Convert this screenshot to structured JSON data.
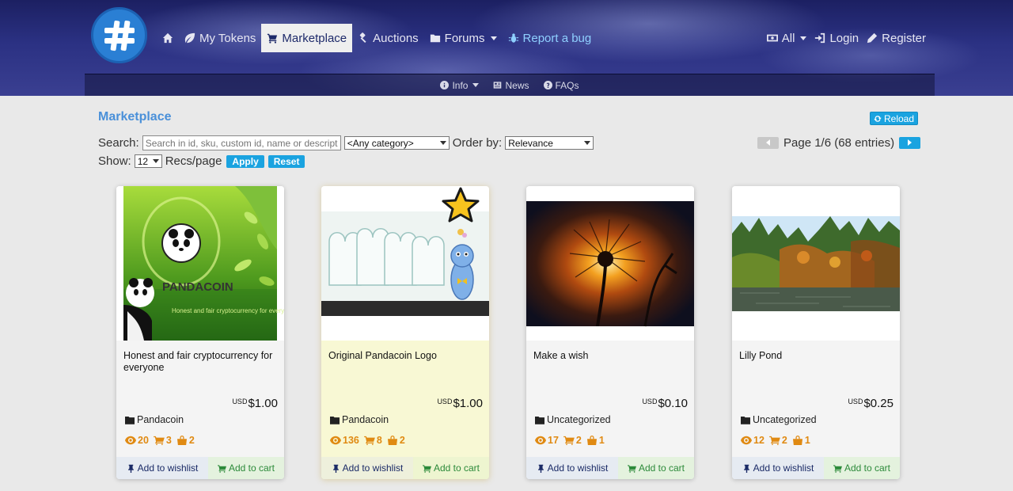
{
  "nav": {
    "home_label": "",
    "items": [
      {
        "label": "My Tokens"
      },
      {
        "label": "Marketplace"
      },
      {
        "label": "Auctions"
      },
      {
        "label": "Forums"
      },
      {
        "label": "Report a bug"
      }
    ],
    "right": [
      {
        "label": "All"
      },
      {
        "label": "Login"
      },
      {
        "label": "Register"
      }
    ]
  },
  "subnav": [
    {
      "label": "Info"
    },
    {
      "label": "News"
    },
    {
      "label": "FAQs"
    }
  ],
  "page": {
    "title": "Marketplace",
    "reload_label": "Reload"
  },
  "filters": {
    "search_label": "Search:",
    "search_placeholder": "Search in id, sku, custom id, name or description",
    "category_value": "<Any category>",
    "order_label": "Order by:",
    "order_value": "Relevance",
    "show_label": "Show:",
    "show_value": "12",
    "recs_label": "Recs/page",
    "apply_label": "Apply",
    "reset_label": "Reset"
  },
  "pager": {
    "text": "Page 1/6 (68 entries)"
  },
  "colors": {
    "accent": "#1aa3e0",
    "title": "#4a90d9",
    "stats": "#e08a12"
  },
  "cards": [
    {
      "title": "Honest and fair cryptocurrency for everyone",
      "currency": "USD",
      "price": "$1.00",
      "category": "Pandacoin",
      "views": "20",
      "carts": "3",
      "sold": "2",
      "featured": false,
      "image_text": "PANDACOIN",
      "image_tagline": "Honest and fair cryptocurrency for everyone",
      "wishlist_label": "Add to wishlist",
      "cart_label": "Add to cart"
    },
    {
      "title": "Original Pandacoin Logo",
      "currency": "USD",
      "price": "$1.00",
      "category": "Pandacoin",
      "views": "136",
      "carts": "8",
      "sold": "2",
      "featured": true,
      "wishlist_label": "Add to wishlist",
      "cart_label": "Add to cart"
    },
    {
      "title": "Make a wish",
      "currency": "USD",
      "price": "$0.10",
      "category": "Uncategorized",
      "views": "17",
      "carts": "2",
      "sold": "1",
      "featured": false,
      "wishlist_label": "Add to wishlist",
      "cart_label": "Add to cart"
    },
    {
      "title": "Lilly Pond",
      "currency": "USD",
      "price": "$0.25",
      "category": "Uncategorized",
      "views": "12",
      "carts": "2",
      "sold": "1",
      "featured": false,
      "wishlist_label": "Add to wishlist",
      "cart_label": "Add to cart"
    }
  ]
}
